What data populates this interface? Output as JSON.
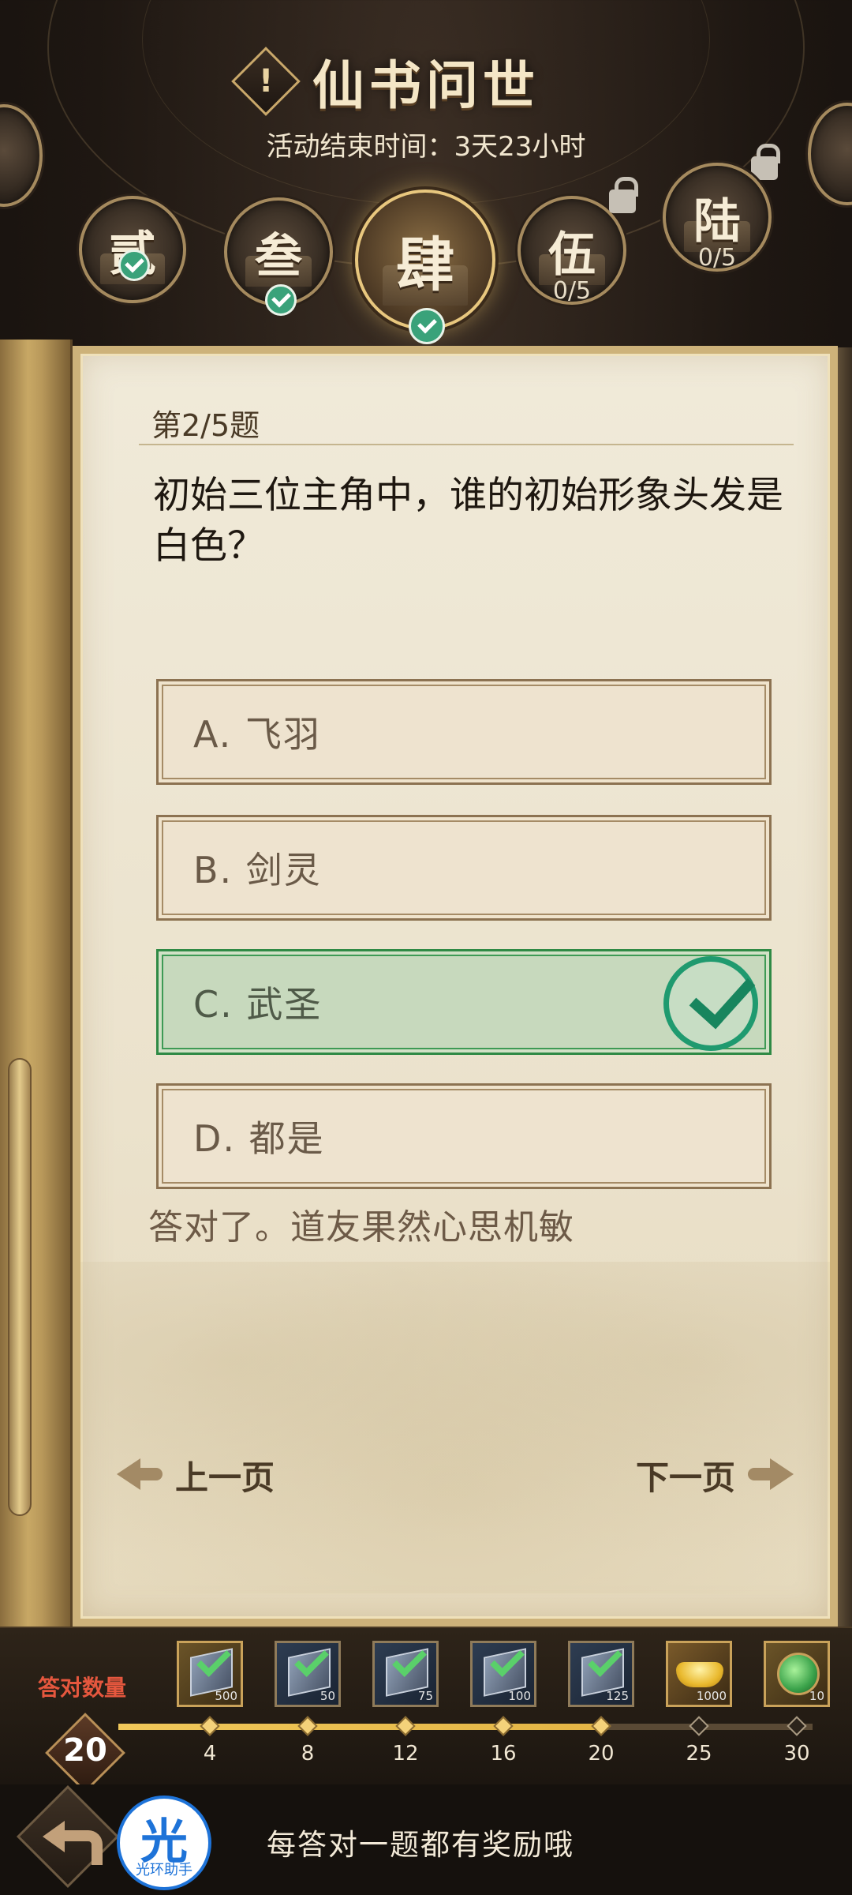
{
  "header": {
    "title": "仙书问世",
    "end_time": "活动结束时间：3天23小时",
    "info_icon_label": "!"
  },
  "chapters": [
    {
      "glyph": "贰",
      "status": "completed"
    },
    {
      "glyph": "叁",
      "status": "completed"
    },
    {
      "glyph": "肆",
      "status": "completed",
      "active": true
    },
    {
      "glyph": "伍",
      "progress": "0/5",
      "status": "locked"
    },
    {
      "glyph": "陆",
      "progress": "0/5",
      "status": "locked"
    }
  ],
  "quiz": {
    "question_number": "第2/5题",
    "question": "初始三位主角中，谁的初始形象头发是白色？",
    "options": [
      {
        "label": "A. 飞羽",
        "state": "normal"
      },
      {
        "label": "B. 剑灵",
        "state": "normal"
      },
      {
        "label": "C. 武圣",
        "state": "correct"
      },
      {
        "label": "D. 都是",
        "state": "normal"
      }
    ],
    "feedback": "答对了。道友果然心思机敏",
    "prev_label": "上一页",
    "next_label": "下一页"
  },
  "rewards": {
    "count_label": "答对数量",
    "count_value": "20",
    "progress_fraction": 0.7,
    "milestones": [
      "4",
      "8",
      "12",
      "16",
      "20",
      "25",
      "30"
    ],
    "items": [
      {
        "icon": "gold-book-icon",
        "qty": "500"
      },
      {
        "icon": "book-icon",
        "qty": "50"
      },
      {
        "icon": "book-icon",
        "qty": "75"
      },
      {
        "icon": "book-icon",
        "qty": "100"
      },
      {
        "icon": "book-icon",
        "qty": "125"
      },
      {
        "icon": "gold-ingot-icon",
        "qty": "1000"
      },
      {
        "icon": "jade-icon",
        "qty": "10"
      }
    ]
  },
  "bottom": {
    "tip": "每答对一题都有奖励哦",
    "app_logo_glyph": "光",
    "app_logo_name": "光环助手"
  },
  "colors": {
    "correct_green": "#2f8a45",
    "accent_gold": "#cdb27a",
    "count_red": "#e5573e"
  }
}
